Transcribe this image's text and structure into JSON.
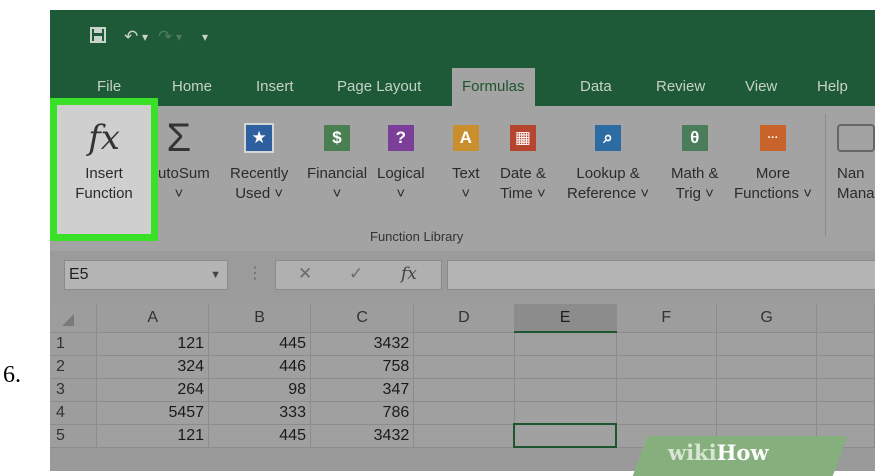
{
  "step_number": "6.",
  "quick_access": {
    "save_icon": "save-icon",
    "undo_icon": "undo-icon",
    "redo_icon": "redo-icon",
    "customize_icon": "customize-qat-icon"
  },
  "tabs": [
    {
      "label": "File"
    },
    {
      "label": "Home"
    },
    {
      "label": "Insert"
    },
    {
      "label": "Page Layout"
    },
    {
      "label": "Formulas",
      "active": true
    },
    {
      "label": "Data"
    },
    {
      "label": "Review"
    },
    {
      "label": "View"
    },
    {
      "label": "Help"
    }
  ],
  "ribbon": {
    "insert_function": {
      "glyph": "fx",
      "line1": "Insert",
      "line2": "Function"
    },
    "autosum": {
      "glyph": "Σ",
      "line1": "AutoSum",
      "line2": "˅"
    },
    "recently_used": {
      "glyph": "★",
      "line1": "Recently",
      "line2": "Used ˅"
    },
    "financial": {
      "glyph": "$",
      "line1": "Financial",
      "line2": "˅"
    },
    "logical": {
      "glyph": "?",
      "line1": "Logical",
      "line2": "˅"
    },
    "text": {
      "glyph": "A",
      "line1": "Text",
      "line2": "˅"
    },
    "date_time": {
      "glyph": "▦",
      "line1": "Date &",
      "line2": "Time ˅"
    },
    "lookup": {
      "glyph": "⌕",
      "line1": "Lookup &",
      "line2": "Reference ˅"
    },
    "math_trig": {
      "glyph": "θ",
      "line1": "Math &",
      "line2": "Trig ˅"
    },
    "more_functions": {
      "glyph": "···",
      "line1": "More",
      "line2": "Functions ˅"
    },
    "name_manager": {
      "line1": "Nan",
      "line2": "Mana"
    },
    "group_label": "Function Library"
  },
  "formula_bar": {
    "name_box": "E5",
    "cancel": "✕",
    "enter": "✓",
    "fx": "fx",
    "value": ""
  },
  "grid": {
    "columns": [
      "A",
      "B",
      "C",
      "D",
      "E",
      "F",
      "G"
    ],
    "selected_column": "E",
    "rows": [
      {
        "n": "1",
        "A": "121",
        "B": "445",
        "C": "3432"
      },
      {
        "n": "2",
        "A": "324",
        "B": "446",
        "C": "758"
      },
      {
        "n": "3",
        "A": "264",
        "B": "98",
        "C": "347"
      },
      {
        "n": "4",
        "A": "5457",
        "B": "333",
        "C": "786"
      },
      {
        "n": "5",
        "A": "121",
        "B": "445",
        "C": "3432"
      }
    ]
  },
  "watermark": {
    "wiki": "wiki",
    "how": "How"
  },
  "colors": {
    "accent_green": "#39e028",
    "excel_green": "#1e5a37"
  }
}
